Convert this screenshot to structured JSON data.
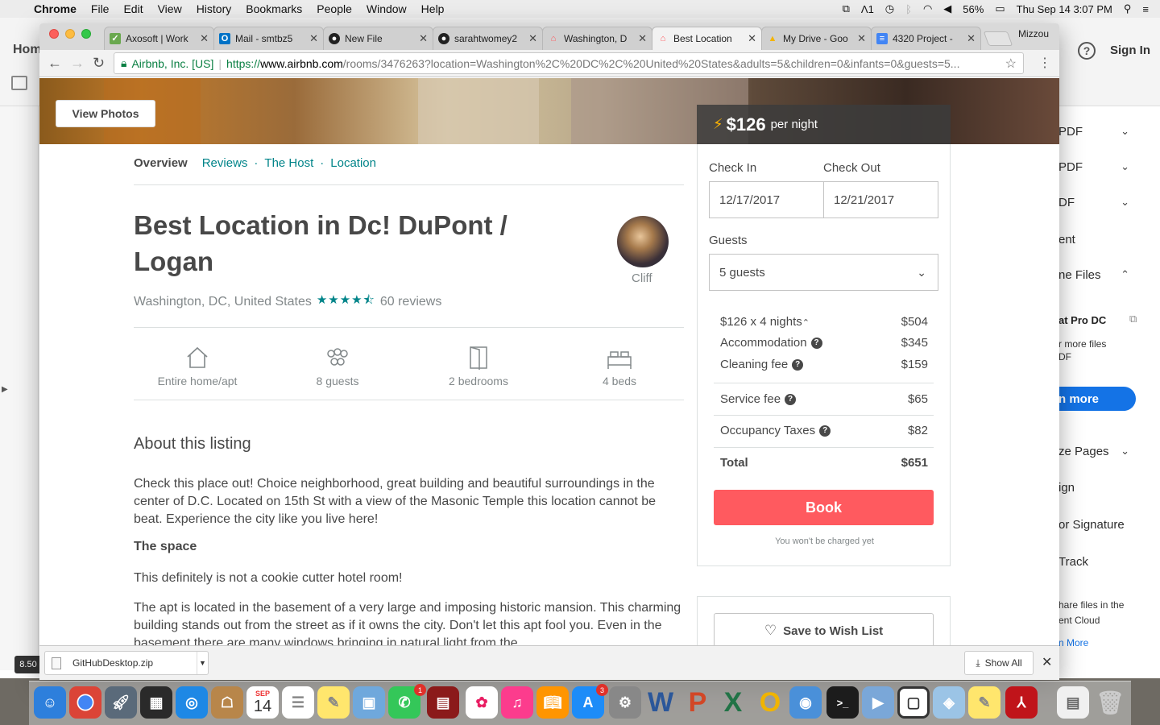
{
  "menubar": {
    "app": "Chrome",
    "items": [
      "File",
      "Edit",
      "View",
      "History",
      "Bookmarks",
      "People",
      "Window",
      "Help"
    ],
    "status": {
      "battery": "56%",
      "clock": "Thu Sep 14  3:07 PM",
      "indicator": "1"
    }
  },
  "acrobat": {
    "home": "Hom",
    "sign_in": "Sign In",
    "panel_items": [
      {
        "label": "PDF",
        "chevron": "down"
      },
      {
        "label": "PDF",
        "chevron": "down"
      },
      {
        "label": "DF",
        "chevron": "down"
      },
      {
        "label": "ent",
        "chevron": ""
      },
      {
        "label": "ne Files",
        "chevron": "up"
      }
    ],
    "pro_title": "at Pro DC",
    "pro_sub1": "r more files",
    "pro_sub2": "DF",
    "more_btn": "n more",
    "tools": [
      {
        "label": "ze Pages",
        "chevron": "down"
      },
      {
        "label": "ign",
        "chevron": ""
      },
      {
        "label": "or Signature",
        "chevron": ""
      },
      {
        "label": "Track",
        "chevron": ""
      }
    ],
    "share1": "hare files in the",
    "share2": "ent Cloud",
    "learn": "n More",
    "zoom": "8.50"
  },
  "browser": {
    "tabs": [
      {
        "title": "Axosoft | Work",
        "icon": "axosoft-icon",
        "color": "#6aa84f"
      },
      {
        "title": "Mail - smtbz5",
        "icon": "outlook-icon",
        "color": "#0072c6"
      },
      {
        "title": "New File",
        "icon": "github-icon",
        "color": "#222222"
      },
      {
        "title": "sarahtwomey2",
        "icon": "github-icon",
        "color": "#222222"
      },
      {
        "title": "Washington, D",
        "icon": "airbnb-icon",
        "color": "#ff5a5f"
      },
      {
        "title": "Best Location",
        "icon": "airbnb-icon",
        "color": "#ff5a5f",
        "active": true
      },
      {
        "title": "My Drive - Goo",
        "icon": "drive-icon",
        "color": "#f4b400"
      },
      {
        "title": "4320 Project -",
        "icon": "docs-icon",
        "color": "#4285f4"
      }
    ],
    "profile": "Mizzou",
    "url": {
      "org": "Airbnb, Inc. [US]",
      "scheme": "https://",
      "host": "www.airbnb.com",
      "path": "/rooms/3476263?location=Washington%2C%20DC%2C%20United%20States&adults=5&children=0&infants=0&guests=5..."
    }
  },
  "listing": {
    "view_photos": "View Photos",
    "price": "$126",
    "per_night": "per night",
    "subnav": {
      "overview": "Overview",
      "reviews": "Reviews",
      "host": "The Host",
      "location": "Location"
    },
    "title": "Best Location in Dc! DuPont / Logan",
    "host_name": "Cliff",
    "location": "Washington, DC, United States",
    "rating": 4.5,
    "stars": "★★★★⯪",
    "reviews": "60 reviews",
    "amenities": [
      {
        "label": "Entire home/apt",
        "icon": "home-icon"
      },
      {
        "label": "8 guests",
        "icon": "guests-icon"
      },
      {
        "label": "2 bedrooms",
        "icon": "door-icon"
      },
      {
        "label": "4 beds",
        "icon": "bed-icon"
      }
    ],
    "about_heading": "About this listing",
    "about_text": "Check this place out! Choice neighborhood, great building and beautiful surroundings in the center of D.C. Located on 15th St with a view of the Masonic Temple this location cannot be beat. Experience the city like you live here!",
    "space_heading": "The space",
    "space_text1": "This definitely is not a cookie cutter hotel room!",
    "space_text2": "The apt is located in the basement of a very large and imposing historic mansion. This charming building stands out from the street as if it owns the city. Don't let this apt fool you. Even in the basement there are many windows bringing in natural light from the"
  },
  "booking": {
    "check_in_label": "Check In",
    "check_out_label": "Check Out",
    "check_in": "12/17/2017",
    "check_out": "12/21/2017",
    "guests_label": "Guests",
    "guests": "5 guests",
    "nights_label": "$126 x 4 nights",
    "nights_total": "$504",
    "accommodation_label": "Accommodation",
    "accommodation": "$345",
    "cleaning_label": "Cleaning fee",
    "cleaning": "$159",
    "service_label": "Service fee",
    "service": "$65",
    "taxes_label": "Occupancy Taxes",
    "taxes": "$82",
    "total_label": "Total",
    "total": "$651",
    "book": "Book",
    "note": "You won't be charged yet",
    "wishlist": "Save to Wish List"
  },
  "downloads": {
    "file": "GitHubDesktop.zip",
    "show_all": "Show All"
  },
  "dock": {
    "calendar_month": "SEP",
    "calendar_day": "14",
    "messages_badge": "1",
    "appstore_badge": "3"
  }
}
